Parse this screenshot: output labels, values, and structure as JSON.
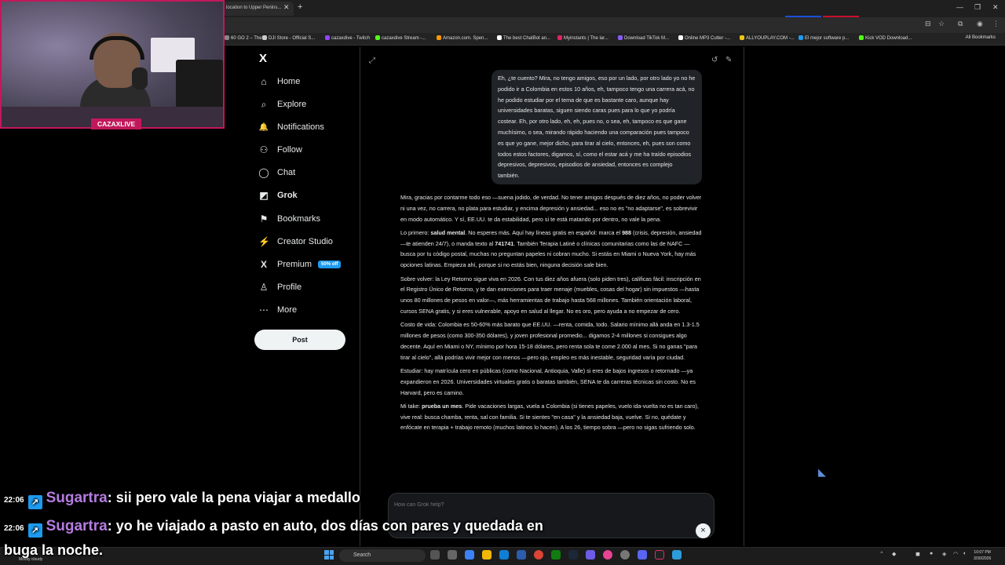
{
  "browser": {
    "active_tab_title": "location to Upper Penins...",
    "bookmarks": [
      {
        "label": "60 GO 2 – The...",
        "color": "#888888"
      },
      {
        "label": "DJI Store - Official S...",
        "color": "#cccccc"
      },
      {
        "label": "cazaxdive - Twitch",
        "color": "#9146ff"
      },
      {
        "label": "cazaxdive Stream -...",
        "color": "#53fc18"
      },
      {
        "label": "Amazon.com. Spen...",
        "color": "#ff9900"
      },
      {
        "label": "The best ChatBot an...",
        "color": "#ffffff"
      },
      {
        "label": "Myinstants | The lar...",
        "color": "#e0245e"
      },
      {
        "label": "Download TikTok M...",
        "color": "#8a5cf6"
      },
      {
        "label": "Online MP3 Cutter -...",
        "color": "#ffffff"
      },
      {
        "label": "ALLYOUPLAY.COM -...",
        "color": "#f0c419"
      },
      {
        "label": "El mejor software p...",
        "color": "#1d9bf0"
      },
      {
        "label": "Kick VOD Download...",
        "color": "#53fc18"
      }
    ],
    "all_bookmarks": "All Bookmarks"
  },
  "sidebar": {
    "logo": "X",
    "items": [
      {
        "label": "Home",
        "icon": "home-icon",
        "glyph": "⌂"
      },
      {
        "label": "Explore",
        "icon": "search-icon",
        "glyph": "⌕"
      },
      {
        "label": "Notifications",
        "icon": "bell-icon",
        "glyph": "🔔"
      },
      {
        "label": "Follow",
        "icon": "follow-icon",
        "glyph": "⚇"
      },
      {
        "label": "Chat",
        "icon": "chat-icon",
        "glyph": "◯"
      },
      {
        "label": "Grok",
        "icon": "grok-icon",
        "glyph": "◩"
      },
      {
        "label": "Bookmarks",
        "icon": "bookmark-icon",
        "glyph": "⚑"
      },
      {
        "label": "Creator Studio",
        "icon": "creator-studio-icon",
        "glyph": "⚡"
      },
      {
        "label": "Premium",
        "icon": "premium-icon",
        "glyph": "X"
      },
      {
        "label": "Profile",
        "icon": "profile-icon",
        "glyph": "♙"
      },
      {
        "label": "More",
        "icon": "more-icon",
        "glyph": "⋯"
      }
    ],
    "premium_badge": "50% off",
    "post_label": "Post"
  },
  "grok": {
    "user_message": "Eh, ¿te cuento? Mira, no tengo amigos, eso por un lado, por otro lado yo no he podido ir a Colombia en estos 10 años, eh, tampoco tengo una carrera acá, no he podido estudiar por el tema de que es bastante caro, aunque hay universidades baratas, siguen siendo caras pues para lo que yo podría costear. Eh, por otro lado, eh, eh, pues no, o sea, eh, tampoco es que gane muchísimo, o sea, mirando rápido haciendo una comparación pues tampoco es que yo gane, mejor dicho, para tirar al cielo, entonces, eh, pues son como todos estos factores, digamos, sí, como el estar acá y me ha traído episodios depresivos, depresivos, episodios de ansiedad, entonces es complejo también.",
    "reply_p1": "Mira, gracias por contarme todo eso —suena jodido, de verdad. No tener amigos después de diez años, no poder volver ni una vez, no carrera, no plata para estudiar, y encima depresión y ansiedad... eso no es \"no adaptarse\", es sobrevivir en modo automático. Y sí, EE.UU. te da estabilidad, pero si te está matando por dentro, no vale la pena.",
    "reply_p2_lead": "Lo primero: ",
    "reply_p2_bold": "salud mental",
    "reply_p2_a": ". No esperes más. Aquí hay líneas gratis en español: marca el ",
    "reply_p2_num1": "988",
    "reply_p2_b": " (crisis, depresión, ansiedad —te atienden 24/7), o manda texto al ",
    "reply_p2_num2": "741741",
    "reply_p2_c": ". También Terapia Latiné o clínicas comunitarias como las de NAFC —busca por tu código postal, muchas no preguntan papeles ni cobran mucho. Si estás en Miami o Nueva York, hay más opciones latinas. Empieza ahí, porque si no estás bien, ninguna decisión sale bien.",
    "reply_p3": "Sobre volver: la Ley Retorno sigue viva en 2026. Con tus diez años afuera (solo piden tres), calificas fácil: inscripción en el Registro Único de Retorno, y te dan exenciones para traer menaje (muebles, cosas del hogar) sin impuestos —hasta unos 80 millones de pesos en valor—, más herramientas de trabajo hasta 568 millones. También orientación laboral, cursos SENA gratis, y si eres vulnerable, apoyo en salud al llegar. No es oro, pero ayuda a no empezar de cero.",
    "reply_p4": "Costo de vida: Colombia es 50-60% más barato que EE.UU. —renta, comida, todo. Salario mínimo allá anda en 1.3-1.5 millones de pesos (como 300-350 dólares), y joven profesional promedio... digamos 2-4 millones si consigues algo decente. Aquí en Miami o NY, mínimo por hora 15-18 dólares, pero renta sola te come 2.000 al mes. Si no ganas \"para tirar al cielo\", allá podrías vivir mejor con menos —pero ojo, empleo es más inestable, seguridad varía por ciudad.",
    "reply_p5": "Estudiar: hay matrícula cero en públicas (como Nacional, Antioquia, Valle) si eres de bajos ingresos o retornado —ya expandieron en 2026. Universidades virtuales gratis o baratas también, SENA te da carreras técnicas sin costo. No es Harvard, pero es camino.",
    "reply_p6_lead": "Mi take: ",
    "reply_p6_bold": "prueba un mes",
    "reply_p6_rest": ". Pide vacaciones largas, vuela a Colombia (si tienes papeles, vuelo ida-vuelta no es tan caro), vive real: busca chamba, renta, sal con familia. Si te sientes \"en casa\" y la ansiedad baja, vuelve. Si no, quédate y enfócate en terapia + trabajo remoto (muchos latinos lo hacen). A los 26, tiempo sobra —pero no sigas sufriendo solo.",
    "ask_placeholder": "How can Grok help?",
    "close_glyph": "×"
  },
  "webcam": {
    "label": "CAZAXLIVE",
    "accent": "#c2185b"
  },
  "chat": [
    {
      "time": "22:06",
      "user": "Sugartra",
      "message": ": sii pero vale la pena viajar a medallo"
    },
    {
      "time": "22:06",
      "user": "Sugartra",
      "message": ": yo he viajado a pasto en auto, dos días con pares y quedada en"
    }
  ],
  "chat_continuation": "buga la noche.",
  "taskbar": {
    "weather": "Mostly cloudy",
    "search_label": "Search",
    "time": "10:07 PM",
    "date": "3/30/2026"
  }
}
